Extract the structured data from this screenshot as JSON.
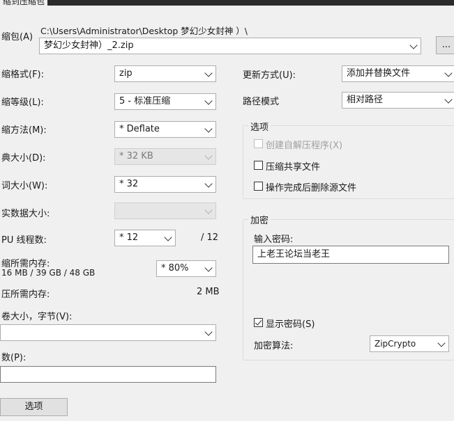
{
  "window": {
    "title_fragment": "缩到压缩包"
  },
  "archive": {
    "label": "缩包(A)",
    "folder_path": "C:\\Users\\Administrator\\Desktop 梦幻少女封神 ）\\",
    "filename": "梦幻少女封神）_2.zip",
    "browse_label": "..."
  },
  "format": {
    "label": "缩格式(F):",
    "value": "zip"
  },
  "level": {
    "label": "缩等级(L):",
    "value": "5 - 标准压缩"
  },
  "method": {
    "label": "缩方法(M):",
    "value": "* Deflate"
  },
  "dictionary": {
    "label": "典大小(D):",
    "value": "* 32 KB"
  },
  "word": {
    "label": "词大小(W):",
    "value": "* 32"
  },
  "solid": {
    "label": "实数据大小:",
    "value": ""
  },
  "threads": {
    "label": "PU 线程数:",
    "value": "* 12",
    "max": "/ 12"
  },
  "memory": {
    "compress_label": "缩所需内存:",
    "compress_values": "16 MB / 39 GB / 48 GB",
    "compress_percent": "* 80%",
    "decompress_label": "压所需内存:",
    "decompress_value": "2 MB"
  },
  "volume": {
    "label": "卷大小，字节(V):",
    "value": ""
  },
  "params": {
    "label": "数(P):",
    "value": ""
  },
  "options_button": "选项",
  "update": {
    "label": "更新方式(U):",
    "value": "添加并替换文件"
  },
  "path_mode": {
    "label": "路径模式",
    "value": "相对路径"
  },
  "options_group": {
    "title": "选项",
    "sfx": "创建自解压程序(X)",
    "shared": "压缩共享文件",
    "delete": "操作完成后删除源文件"
  },
  "encryption": {
    "title": "加密",
    "password_label": "输入密码:",
    "password_value": "上老王论坛当老王",
    "show_password": "显示密码(S)",
    "method_label": "加密算法:",
    "method_value": "ZipCrypto"
  }
}
